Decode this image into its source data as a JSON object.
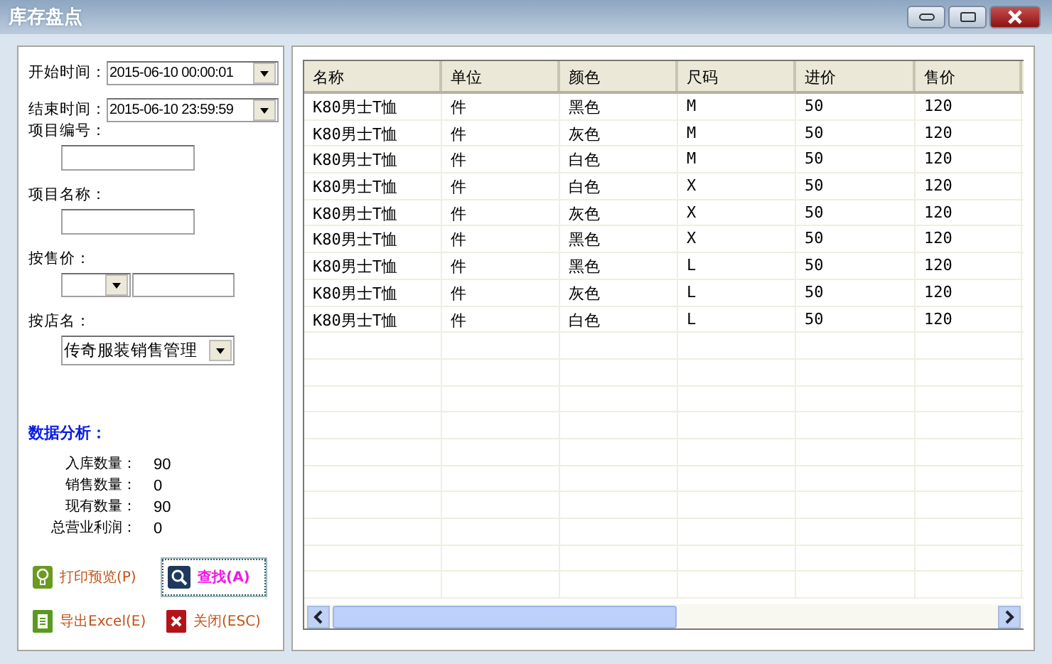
{
  "window": {
    "title": "库存盘点"
  },
  "filters": {
    "start_time": {
      "label": "开始时间：",
      "value": "2015-06-10 00:00:01"
    },
    "end_time": {
      "label": "结束时间：",
      "value": "2015-06-10 23:59:59"
    },
    "item_number": {
      "label": "项目编号："
    },
    "item_name": {
      "label": "项目名称："
    },
    "sale_price": {
      "label": "按售价："
    },
    "store": {
      "label": "按店名：",
      "value": "传奇服装销售管理"
    }
  },
  "analysis": {
    "title": "数据分析：",
    "stats": [
      {
        "label": "入库数量：",
        "value": "90"
      },
      {
        "label": "销售数量：",
        "value": "0"
      },
      {
        "label": "现有数量：",
        "value": "90"
      },
      {
        "label": "总营业利润：",
        "value": "0"
      }
    ]
  },
  "buttons": [
    {
      "kind": "print",
      "label": "打印预览(P)"
    },
    {
      "kind": "search",
      "label": "查找(A)"
    },
    {
      "kind": "export",
      "label": "导出Excel(E)"
    },
    {
      "kind": "close",
      "label": "关闭(ESC)"
    }
  ],
  "table": {
    "columns": [
      "名称",
      "单位",
      "颜色",
      "尺码",
      "进价",
      "售价"
    ],
    "rows": [
      [
        "K80男士T恤",
        "件",
        "黑色",
        "M",
        "50",
        "120"
      ],
      [
        "K80男士T恤",
        "件",
        "灰色",
        "M",
        "50",
        "120"
      ],
      [
        "K80男士T恤",
        "件",
        "白色",
        "M",
        "50",
        "120"
      ],
      [
        "K80男士T恤",
        "件",
        "白色",
        "X",
        "50",
        "120"
      ],
      [
        "K80男士T恤",
        "件",
        "灰色",
        "X",
        "50",
        "120"
      ],
      [
        "K80男士T恤",
        "件",
        "黑色",
        "X",
        "50",
        "120"
      ],
      [
        "K80男士T恤",
        "件",
        "黑色",
        "L",
        "50",
        "120"
      ],
      [
        "K80男士T恤",
        "件",
        "灰色",
        "L",
        "50",
        "120"
      ],
      [
        "K80男士T恤",
        "件",
        "白色",
        "L",
        "50",
        "120"
      ]
    ]
  }
}
